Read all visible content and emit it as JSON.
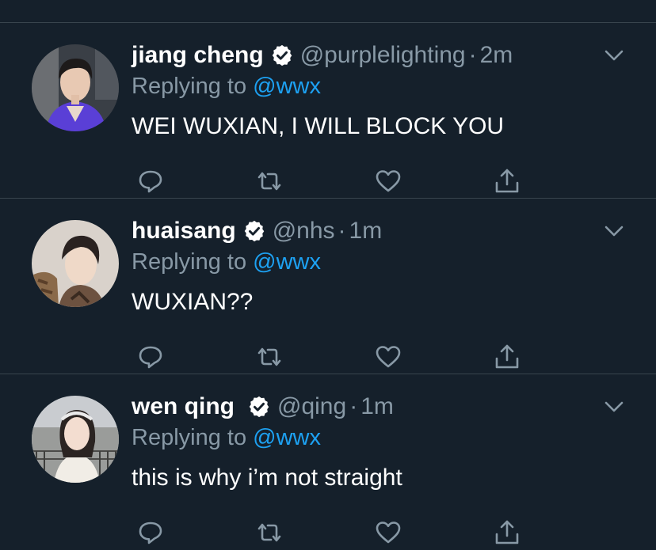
{
  "colors": {
    "background": "#15202b",
    "divider": "#38444d",
    "primary_text": "#ffffff",
    "secondary_text": "#8899a6",
    "link": "#1da1f2",
    "verified_badge": "#ffffff"
  },
  "icons": {
    "reply": "reply-icon",
    "retweet": "retweet-icon",
    "like": "heart-icon",
    "share": "share-icon",
    "more": "chevron-down-icon",
    "verified": "verified-badge-icon"
  },
  "tweets": [
    {
      "display_name": "jiang cheng",
      "verified": true,
      "handle": "@purplelighting",
      "separator": "·",
      "time": "2m",
      "replying_prefix": "Replying to",
      "replying_to": "@wwx",
      "text": "WEI WUXIAN, I WILL BLOCK YOU"
    },
    {
      "display_name": "huaisang",
      "verified": true,
      "handle": "@nhs",
      "separator": "·",
      "time": "1m",
      "replying_prefix": "Replying to",
      "replying_to": "@wwx",
      "text": "WUXIAN??"
    },
    {
      "display_name": "wen qing",
      "verified": true,
      "handle": "@qing",
      "separator": "·",
      "time": "1m",
      "replying_prefix": "Replying to",
      "replying_to": "@wwx",
      "text": "this is why i’m not straight"
    }
  ]
}
